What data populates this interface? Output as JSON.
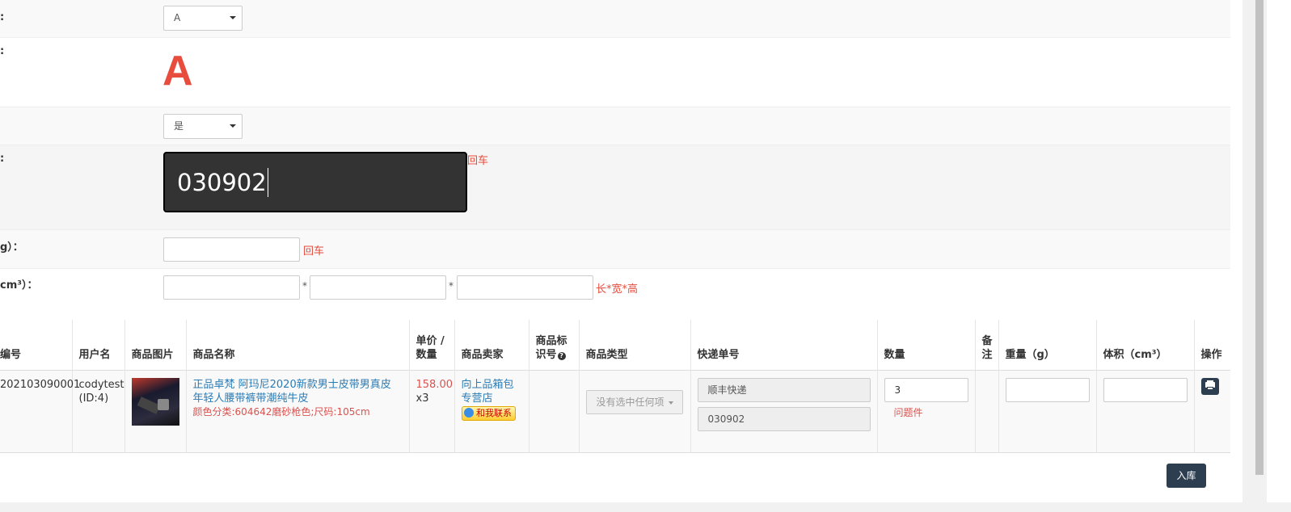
{
  "form": {
    "row1": {
      "label": ":",
      "select_value": "A"
    },
    "row2": {
      "label": ":",
      "big_letter": "A"
    },
    "row3": {
      "select_value": "是"
    },
    "row4": {
      "label": ":",
      "scan_value": "030902",
      "hint": "回车"
    },
    "row5": {
      "label": "g）：",
      "hint": "回车"
    },
    "row6": {
      "label": "cm³）：",
      "star1": "*",
      "star2": "*",
      "hint": "长*宽*高"
    }
  },
  "table": {
    "headers": [
      "编号",
      "用户名",
      "商品图片",
      "商品名称",
      "单价 / 数量",
      "商品卖家",
      "商品标识号",
      "商品类型",
      "快递单号",
      "数量",
      "备注",
      "重量（g）",
      "体积（cm³）",
      "操作"
    ],
    "row": {
      "order_no": "202103090001",
      "user": "codytest",
      "user_id": "(ID:4)",
      "product_name": "正品卓梵 阿玛尼2020新款男士皮带男真皮 年轻人腰带裤带潮纯牛皮",
      "product_spec": "颜色分类:604642磨砂枪色;尺码:105cm",
      "price": "158.00",
      "qty": "x3",
      "seller": "向上品箱包专营店",
      "contact_btn": "和我联系",
      "type_placeholder": "没有选中任何项",
      "courier": "顺丰快递",
      "tracking": "030902",
      "count_value": "3",
      "problem_link": "问题件"
    }
  },
  "footer": {
    "submit_label": "入库"
  }
}
